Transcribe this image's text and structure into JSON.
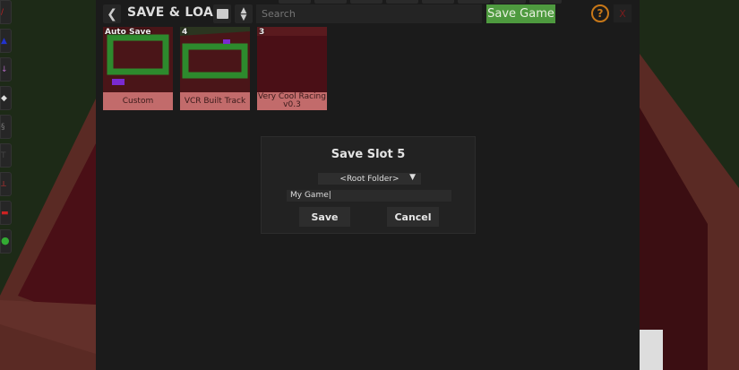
{
  "header": {
    "title": "SAVE & LOA...",
    "search_placeholder": "Search",
    "save_game_label": "Save Game",
    "help_label": "?",
    "close_label": "X",
    "back_icon": "chevron-left-icon",
    "folder_icon": "folder-icon",
    "sort_icon": "sort-icon"
  },
  "saves": [
    {
      "slot": "Auto Save",
      "name": "Custom"
    },
    {
      "slot": "4",
      "name": "VCR Built Track"
    },
    {
      "slot": "3",
      "name": "Very Cool Racing v0.3"
    }
  ],
  "dialog": {
    "title": "Save Slot 5",
    "folder": "<Root Folder>",
    "name_value": "My Game",
    "save_label": "Save",
    "cancel_label": "Cancel"
  },
  "colors": {
    "accent_green": "#4e9a3f",
    "card_label": "#c26b6b",
    "help": "#c87818"
  }
}
